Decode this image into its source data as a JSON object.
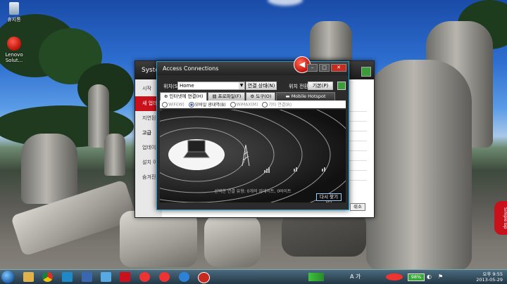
{
  "desktop": {
    "icons": [
      {
        "label": "휴지통",
        "icon": "recycle-bin-icon"
      },
      {
        "label": "Lenovo Solut...",
        "icon": "lenovo-solution-center-icon"
      }
    ],
    "side_tab": "SimpleTap"
  },
  "system_update": {
    "title": "System",
    "nav": [
      "시작",
      "새 업데이트",
      "지연된",
      "고급",
      "업데이트",
      "설치 이력",
      "숨겨진"
    ],
    "close_label": "쉬소"
  },
  "access_connections": {
    "title": "Access Connections",
    "location_label": "위치(S):",
    "location_value": "Home",
    "connection_status_button": "연결 상태(N)",
    "location_switch_label": "위치 전환:",
    "location_switch_value": "기본(P)",
    "tabs": [
      "인터넷에 연결(H)",
      "프로파일(F)",
      "도구(O)",
      "Mobile Hotspot"
    ],
    "radio_options": [
      {
        "label": "WiFi(W)",
        "selected": false,
        "enabled": false
      },
      {
        "label": "모바일 광대역(B)",
        "selected": true,
        "enabled": true
      },
      {
        "label": "WiMAX(M)",
        "selected": false,
        "enabled": false
      },
      {
        "label": "기타 연결(R)",
        "selected": false,
        "enabled": false
      }
    ],
    "status_text": "선택한 연결 유형: 0개의 업데이트, 0바이트",
    "reconnect_button": "다시 찾기(S)"
  },
  "taskbar": {
    "battery": "98%",
    "ime": "A 가",
    "time": "오후 9:55",
    "date": "2013-05-29"
  },
  "colors": {
    "accent": "#1aa0d8",
    "lenovo_red": "#c8111b",
    "battery_green": "#3aa93a"
  }
}
